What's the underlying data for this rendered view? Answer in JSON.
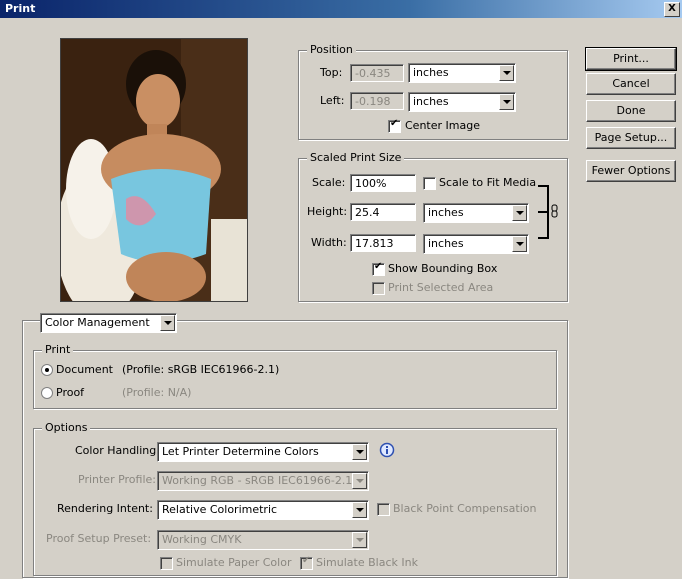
{
  "window": {
    "title": "Print",
    "close": "X"
  },
  "position": {
    "legend": "Position",
    "top_label": "Top:",
    "top_value": "-0.435",
    "top_unit": "inches",
    "left_label": "Left:",
    "left_value": "-0.198",
    "left_unit": "inches",
    "center_label": "Center Image",
    "center_checked": true
  },
  "scaled": {
    "legend": "Scaled Print Size",
    "scale_label": "Scale:",
    "scale_value": "100%",
    "fit_label": "Scale to Fit Media",
    "height_label": "Height:",
    "height_value": "25.4",
    "height_unit": "inches",
    "width_label": "Width:",
    "width_value": "17.813",
    "width_unit": "inches",
    "bbox_label": "Show Bounding Box",
    "bbox_checked": true,
    "selected_label": "Print Selected Area"
  },
  "buttons": {
    "print": "Print...",
    "cancel": "Cancel",
    "done": "Done",
    "page_setup": "Page Setup...",
    "fewer": "Fewer Options"
  },
  "color_mgmt": {
    "dropdown": "Color Management"
  },
  "print_group": {
    "legend": "Print",
    "document_label": "Document",
    "document_profile": "(Profile: sRGB IEC61966-2.1)",
    "proof_label": "Proof",
    "proof_profile": "(Profile: N/A)"
  },
  "options": {
    "legend": "Options",
    "handling_label": "Color Handling:",
    "handling_value": "Let Printer Determine Colors",
    "printer_profile_label": "Printer Profile:",
    "printer_profile_value": "Working RGB - sRGB IEC61966-2.1",
    "intent_label": "Rendering Intent:",
    "intent_value": "Relative Colorimetric",
    "bpc_label": "Black Point Compensation",
    "proof_preset_label": "Proof Setup Preset:",
    "proof_preset_value": "Working CMYK",
    "paper_label": "Simulate Paper Color",
    "ink_label": "Simulate Black Ink"
  },
  "icons": {
    "info": "info-icon",
    "link": "chain-link-icon"
  }
}
